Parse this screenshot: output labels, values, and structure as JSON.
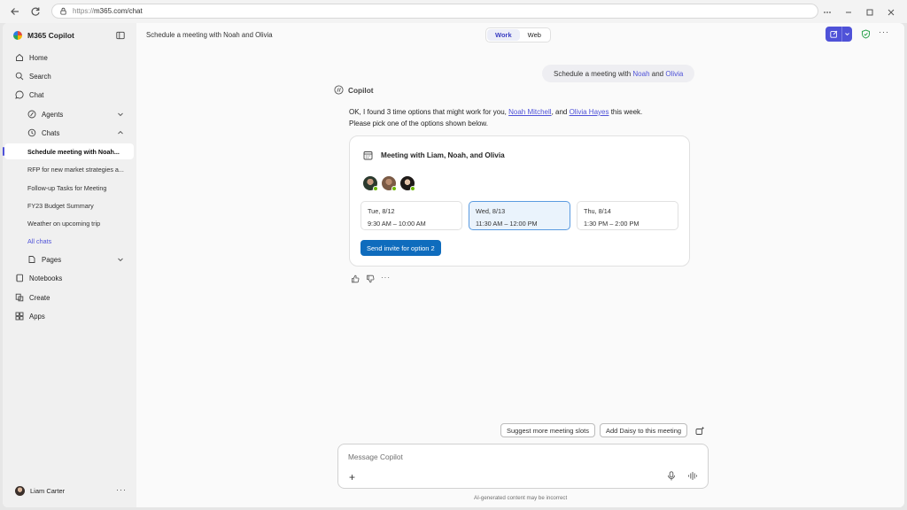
{
  "browser": {
    "url_scheme": "https://",
    "url_rest": "m365.com/chat"
  },
  "sidebar": {
    "brand": "M365 Copilot",
    "nav": {
      "home": "Home",
      "search": "Search",
      "chat": "Chat",
      "agents": "Agents",
      "chats": "Chats",
      "pages": "Pages",
      "notebooks": "Notebooks",
      "create": "Create",
      "apps": "Apps"
    },
    "chat_items": [
      "Schedule meeting with Noah...",
      "RFP for new market strategies a...",
      "Follow-up Tasks for Meeting",
      "FY23 Budget Summary",
      "Weather on upcoming trip"
    ],
    "all_chats": "All chats",
    "user_name": "Liam Carter",
    "more": "···"
  },
  "header": {
    "title": "Schedule a meeting with Noah and Olivia",
    "toggle": [
      "Work",
      "Web"
    ],
    "more": "···"
  },
  "colors": {
    "accent": "#4f52d8",
    "primary_button": "#0f6cbd",
    "selected_option": "#eaf3fc",
    "presence": "#6bb700"
  },
  "conversation": {
    "user_message": {
      "pre": "Schedule a meeting with ",
      "name1": "Noah",
      "mid": " and ",
      "name2": "Olivia"
    },
    "copilot_label": "Copilot",
    "response": {
      "part1": "OK, I found 3 time options that might work for you, ",
      "link1": "Noah Mitchell",
      "part2": ", and ",
      "link2": "Olivia Hayes",
      "part3": " this week.",
      "line2": "Please pick one of the options shown below."
    },
    "card": {
      "title": "Meeting with Liam, Noah, and Olivia",
      "options": [
        {
          "day": "Tue, 8/12",
          "time": "9:30 AM – 10:00 AM"
        },
        {
          "day": "Wed, 8/13",
          "time": "11:30 AM – 12:00 PM"
        },
        {
          "day": "Thu, 8/14",
          "time": "1:30 PM – 2:00 PM"
        }
      ],
      "selected_index": 1,
      "send_button": "Send invite for option 2"
    },
    "feedback_more": "···"
  },
  "suggestions": [
    "Suggest more meeting slots",
    "Add Daisy to this meeting"
  ],
  "composer": {
    "placeholder": "Message Copilot",
    "plus": "+",
    "disclaimer": "AI-generated content may be incorrect"
  }
}
